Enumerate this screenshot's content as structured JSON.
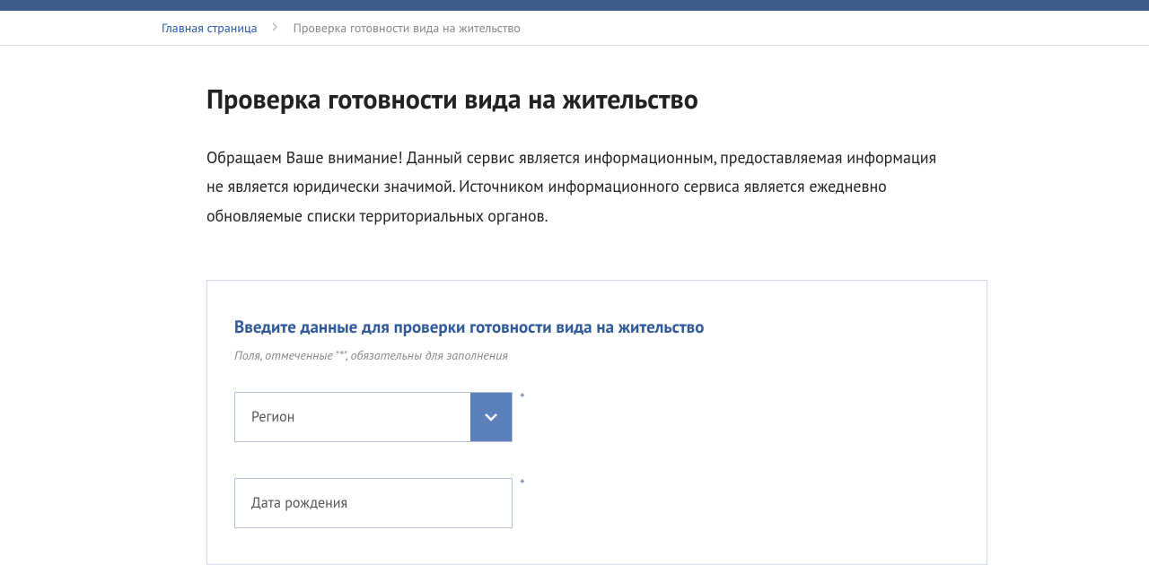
{
  "breadcrumb": {
    "home": "Главная страница",
    "current": "Проверка готовности вида на жительство"
  },
  "page": {
    "title": "Проверка готовности вида на жительство",
    "intro": "Обращаем Ваше внимание! Данный сервис является информационным, предоставляемая информация не является юридически значимой. Источником информационного сервиса является ежедневно обновляемые списки территориальных органов."
  },
  "form": {
    "title": "Введите данные для проверки готовности вида на жительство",
    "note": "Поля, отмеченные \"*\", обязательны для заполнения",
    "region_label": "Регион",
    "dob_placeholder": "Дата рождения",
    "required_mark": "*"
  }
}
